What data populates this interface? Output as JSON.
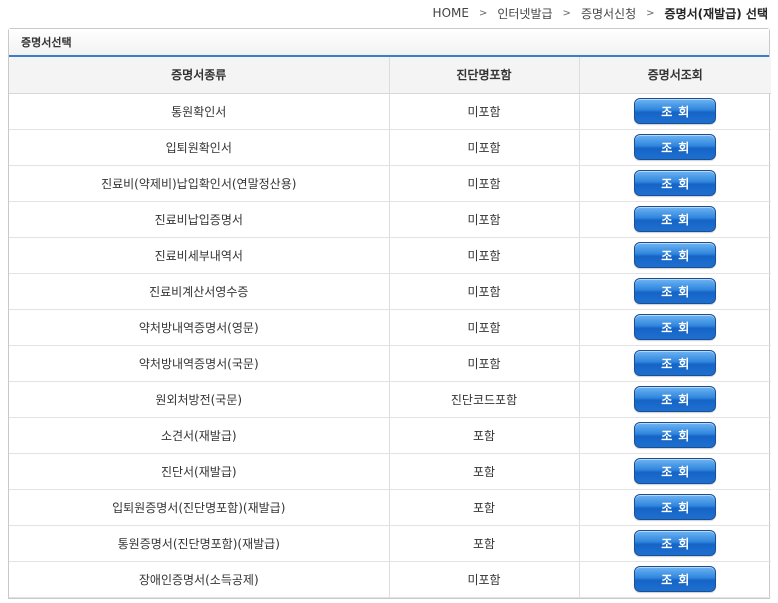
{
  "breadcrumb": {
    "items": [
      "HOME",
      "인터넷발급",
      "증명서신청",
      "증명서(재발급) 선택"
    ],
    "separator": ">"
  },
  "panel": {
    "title": "증명서선택"
  },
  "table": {
    "headers": [
      "증명서종류",
      "진단명포함",
      "증명서조회"
    ],
    "button_label": "조회",
    "rows": [
      {
        "type": "통원확인서",
        "diagnosis": "미포함"
      },
      {
        "type": "입퇴원확인서",
        "diagnosis": "미포함"
      },
      {
        "type": "진료비(약제비)납입확인서(연말정산용)",
        "diagnosis": "미포함"
      },
      {
        "type": "진료비납입증명서",
        "diagnosis": "미포함"
      },
      {
        "type": "진료비세부내역서",
        "diagnosis": "미포함"
      },
      {
        "type": "진료비계산서영수증",
        "diagnosis": "미포함"
      },
      {
        "type": "약처방내역증명서(영문)",
        "diagnosis": "미포함"
      },
      {
        "type": "약처방내역증명서(국문)",
        "diagnosis": "미포함"
      },
      {
        "type": "원외처방전(국문)",
        "diagnosis": "진단코드포함"
      },
      {
        "type": "소견서(재발급)",
        "diagnosis": "포함"
      },
      {
        "type": "진단서(재발급)",
        "diagnosis": "포함"
      },
      {
        "type": "입퇴원증명서(진단명포함)(재발급)",
        "diagnosis": "포함"
      },
      {
        "type": "통원증명서(진단명포함)(재발급)",
        "diagnosis": "포함"
      },
      {
        "type": "장애인증명서(소득공제)",
        "diagnosis": "미포함"
      }
    ]
  },
  "colors": {
    "accent": "#3d7cc9",
    "button": "#2f86de"
  }
}
